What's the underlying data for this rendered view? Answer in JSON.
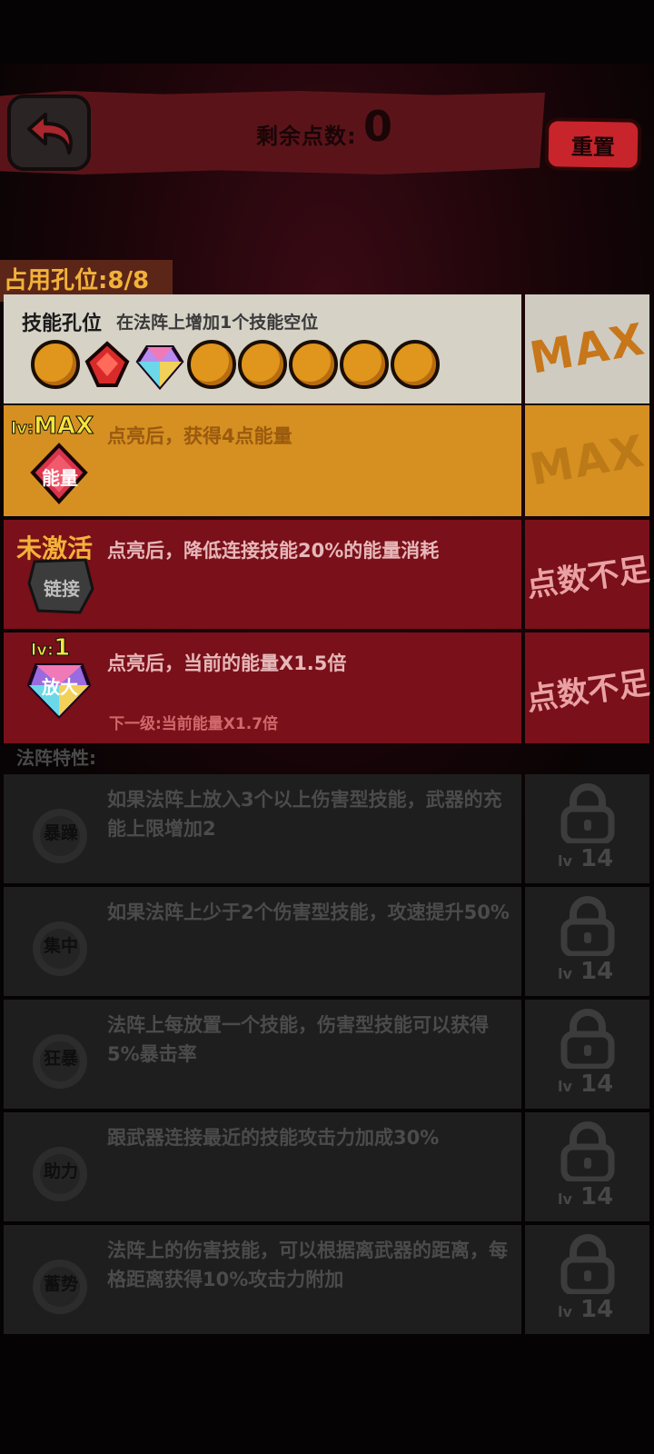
{
  "header": {
    "points_label": "剩余点数:",
    "points_value": "0",
    "reset_label": "重置"
  },
  "slot_tab": "占用孔位:8/8",
  "slots_row": {
    "title": "技能孔位",
    "desc": "在法阵上增加1个技能空位",
    "status": "MAX",
    "icons": [
      "coin",
      "red-gem",
      "rainbow-gem",
      "coin",
      "coin",
      "coin",
      "coin",
      "coin"
    ]
  },
  "energy_row": {
    "level_prefix": "lv:",
    "level": "MAX",
    "badge": "能量",
    "desc": "点亮后，获得4点能量",
    "status": "MAX"
  },
  "link_row": {
    "state": "未激活",
    "badge": "链接",
    "desc": "点亮后，降低连接技能20%的能量消耗",
    "status": "点数不足"
  },
  "amp_row": {
    "level_prefix": "lv:",
    "level": "1",
    "badge": "放大",
    "desc": "点亮后，当前的能量X1.5倍",
    "next": "下一级:当前能量X1.7倍",
    "status": "点数不足"
  },
  "traits_heading": "法阵特性:",
  "traits": [
    {
      "icon": "暴躁",
      "desc": "如果法阵上放入3个以上伤害型技能，武器的充能上限增加2",
      "lv_prefix": "lv",
      "lv": "14"
    },
    {
      "icon": "集中",
      "desc": "如果法阵上少于2个伤害型技能，攻速提升50%",
      "lv_prefix": "lv",
      "lv": "14"
    },
    {
      "icon": "狂暴",
      "desc": "法阵上每放置一个技能，伤害型技能可以获得5%暴击率",
      "lv_prefix": "lv",
      "lv": "14"
    },
    {
      "icon": "助力",
      "desc": "跟武器连接最近的技能攻击力加成30%",
      "lv_prefix": "lv",
      "lv": "14"
    },
    {
      "icon": "蓄势",
      "desc": "法阵上的伤害技能，可以根据离武器的距离，每格距离获得10%攻击力附加",
      "lv_prefix": "lv",
      "lv": "14"
    }
  ],
  "colors": {
    "header": "#5a1419",
    "reset": "#c8242b",
    "slot_row": "#d6d2c6",
    "energy_row": "#d69021",
    "locked_row": "#7a1019",
    "trait_row": "#1e1e1e",
    "accent_yellow": "#f5e63a"
  }
}
